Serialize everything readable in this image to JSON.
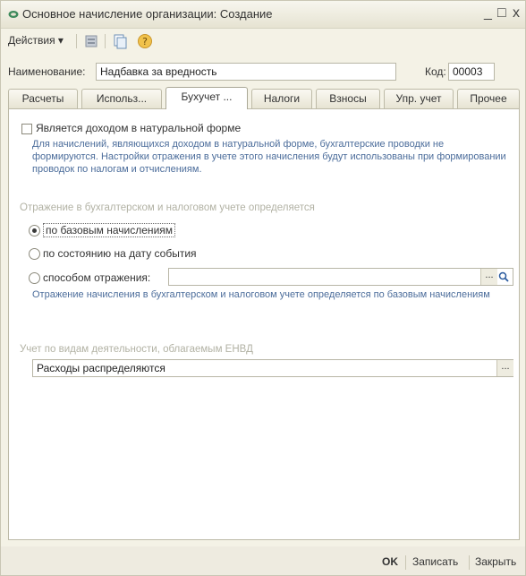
{
  "window": {
    "title": "Основное начисление организации: Создание",
    "minimize_glyph": "_",
    "maximize_glyph": "□",
    "close_glyph": "x",
    "title_icon": "1c-document-icon",
    "accent_color": "#3d8a5c"
  },
  "toolbar": {
    "actions_label": "Действия ▾",
    "icons": [
      "structure-icon",
      "copy-icon",
      "help-icon"
    ]
  },
  "form": {
    "name_label": "Наименование:",
    "name_value": "Надбавка за вредность",
    "code_label": "Код:",
    "code_value": "00003"
  },
  "tabs": [
    {
      "label": "Расчеты",
      "active": false
    },
    {
      "label": "Использ...",
      "active": false
    },
    {
      "label": "Бухучет ...",
      "active": true
    },
    {
      "label": "Налоги",
      "active": false
    },
    {
      "label": "Взносы",
      "active": false
    },
    {
      "label": "Упр. учет",
      "active": false
    },
    {
      "label": "Прочее",
      "active": false
    }
  ],
  "panel": {
    "natural_form_checkbox": "Является доходом в натуральной форме",
    "natural_form_checked": false,
    "natural_form_hint": "Для начислений, являющихся доходом в натуральной форме, бухгалтерские проводки не формируются. Настройки отражения в учете этого начисления будут использованы при формировании проводок по налогам и отчислениям.",
    "section_reflection": "Отражение в бухгалтерском и налоговом учете определяется",
    "radio_base": "по базовым начислениям",
    "radio_state": "по состоянию на дату события",
    "radio_method": "способом отражения:",
    "selected_radio": "base",
    "method_value": "",
    "reflection_hint": "Отражение начисления в бухгалтерском и налоговом учете определяется по базовым начислениям",
    "section_envd": "Учет по видам деятельности, облагаемым ЕНВД",
    "envd_value": "Расходы распределяются",
    "ellipsis": "...",
    "search_glyph": "🔍"
  },
  "footer": {
    "ok": "OK",
    "save": "Записать",
    "close": "Закрыть"
  }
}
